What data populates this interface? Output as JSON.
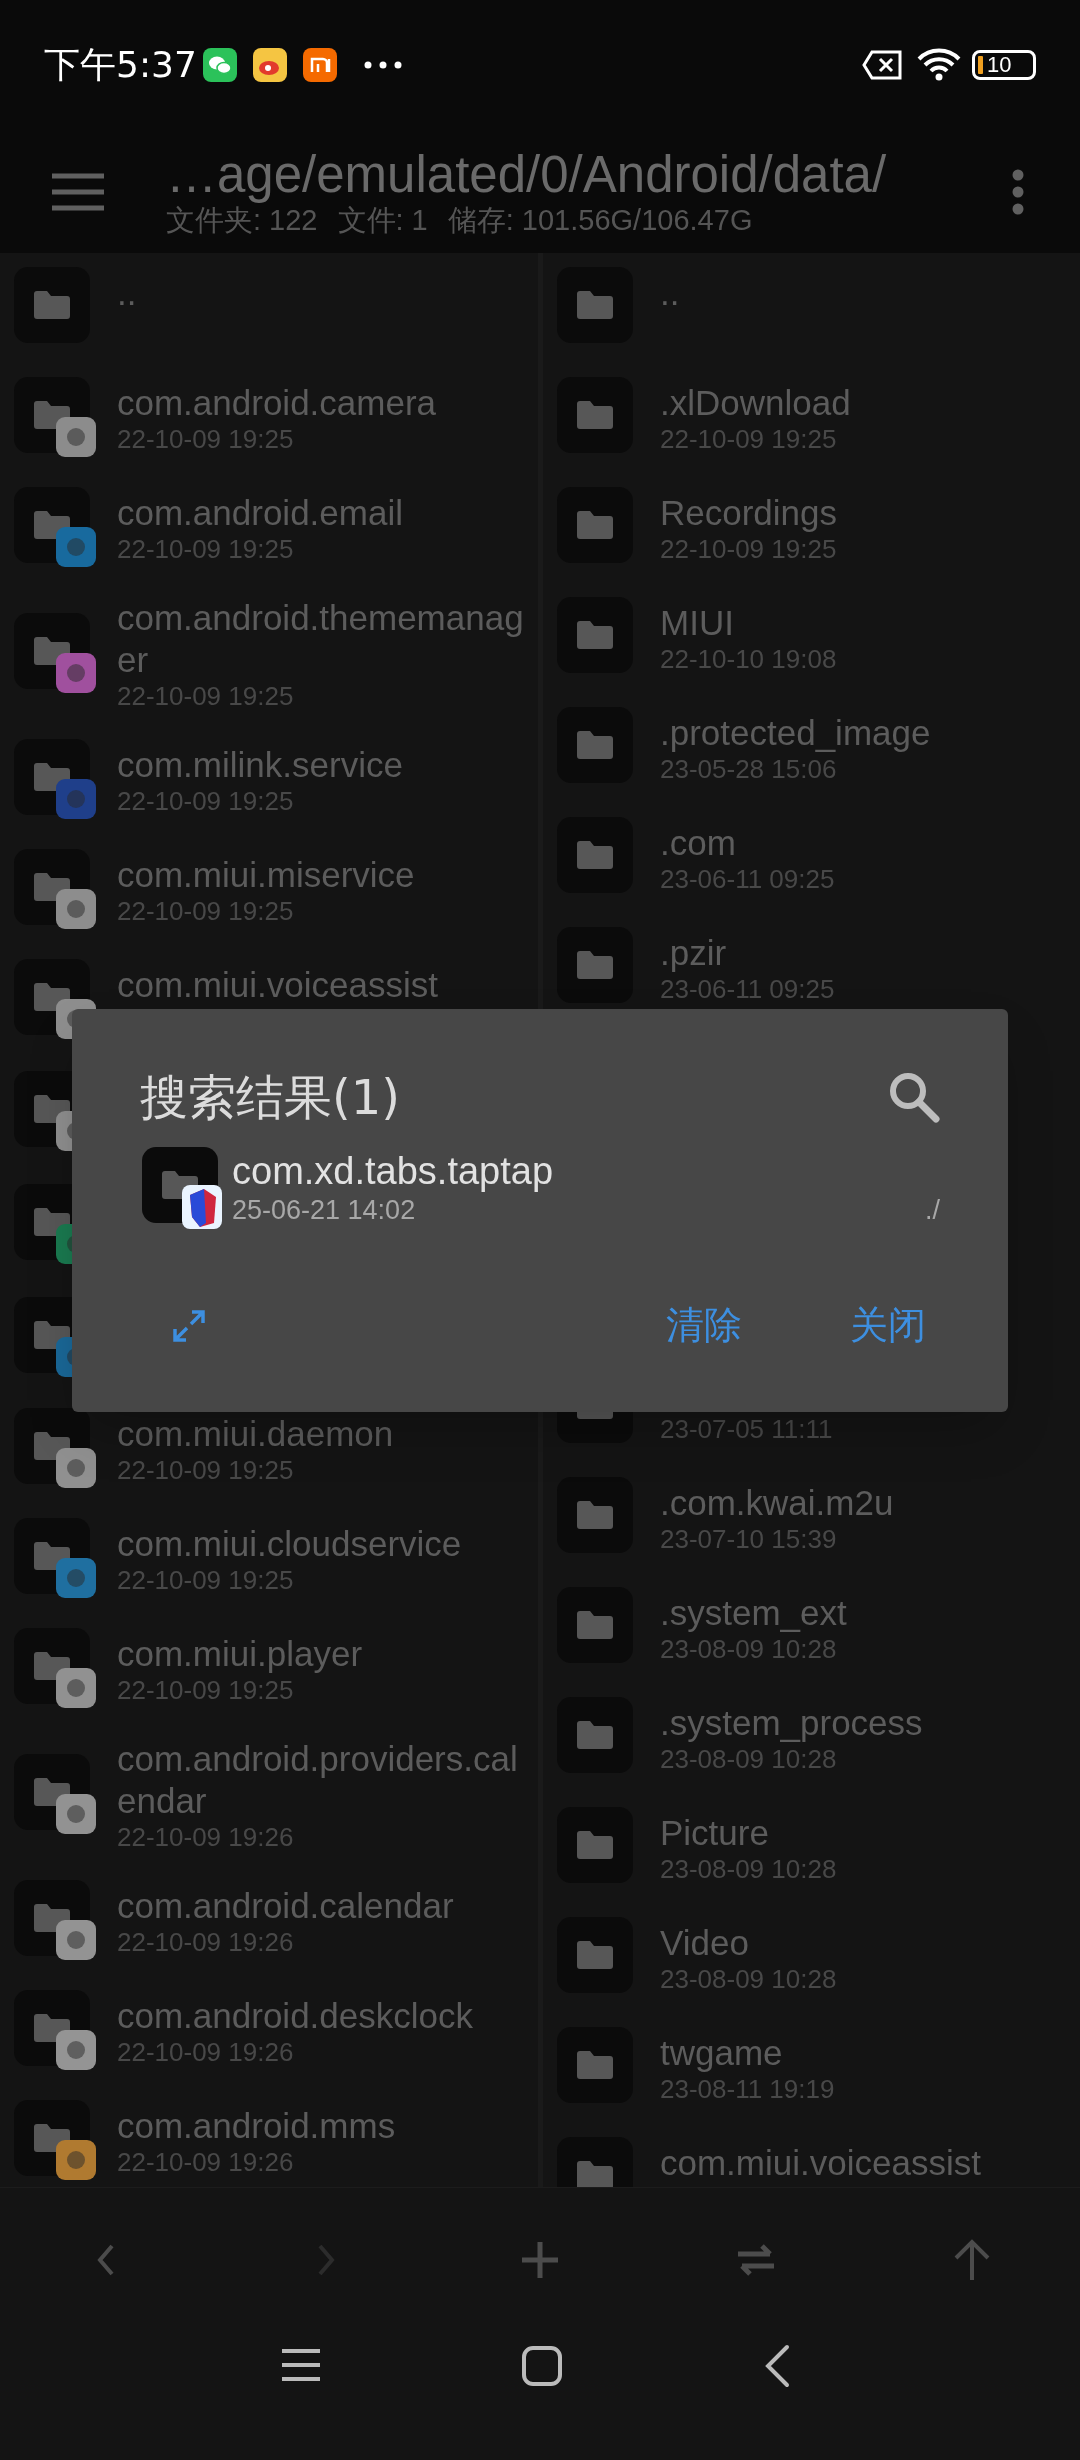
{
  "status_bar": {
    "time": "下午5:37",
    "battery": "10"
  },
  "header": {
    "path": "…age/emulated/0/Android/data/",
    "info": [
      "文件夹: 122",
      "文件: 1",
      "储存: 101.56G/106.47G"
    ]
  },
  "left_pane": {
    "items": [
      {
        "name": ".."
      },
      {
        "name": "com.android.camera",
        "date": "22-10-09 19:25",
        "color": "#8c8c8c"
      },
      {
        "name": "com.android.email",
        "date": "22-10-09 19:25",
        "color": "#186a9e"
      },
      {
        "name": "com.android.thememanager",
        "date": "22-10-09 19:25",
        "color": "#a0509e"
      },
      {
        "name": "com.milink.service",
        "date": "22-10-09 19:25",
        "color": "#1f3f8a"
      },
      {
        "name": "com.miui.miservice",
        "date": "22-10-09 19:25",
        "color": "#8d8d8d"
      },
      {
        "name": "com.miui.voiceassist",
        "color": "#8e8e8e"
      },
      {
        "color": "#8f8f8f"
      },
      {
        "color": "#1a7a50"
      },
      {
        "color": "#1a6898"
      },
      {
        "name": "com.miui.daemon",
        "date": "22-10-09 19:25",
        "color": "#909090"
      },
      {
        "name": "com.miui.cloudservice",
        "date": "22-10-09 19:25",
        "color": "#1f6fa0"
      },
      {
        "name": "com.miui.player",
        "date": "22-10-09 19:25",
        "color": "#919191"
      },
      {
        "name": "com.android.providers.calendar",
        "date": "22-10-09 19:26",
        "color": "#929292"
      },
      {
        "name": "com.android.calendar",
        "date": "22-10-09 19:26",
        "color": "#939393"
      },
      {
        "name": "com.android.deskclock",
        "date": "22-10-09 19:26",
        "color": "#949494"
      },
      {
        "name": "com.android.mms",
        "date": "22-10-09 19:26",
        "color": "#b07a30"
      }
    ]
  },
  "right_pane": {
    "items": [
      {
        "name": ".."
      },
      {
        "name": ".xlDownload",
        "date": "22-10-09 19:25"
      },
      {
        "name": "Recordings",
        "date": "22-10-09 19:25"
      },
      {
        "name": "MIUI",
        "date": "22-10-10 19:08"
      },
      {
        "name": ".protected_image",
        "date": "23-05-28 15:06"
      },
      {
        "name": ".com",
        "date": "23-06-11 09:25"
      },
      {
        "name": ".pzir",
        "date": "23-06-11 09:25"
      },
      {
        "date": "23-07-05 11:11"
      },
      {
        "name": ".com.kwai.m2u",
        "date": "23-07-10 15:39"
      },
      {
        "name": ".system_ext",
        "date": "23-08-09 10:28"
      },
      {
        "name": ".system_process",
        "date": "23-08-09 10:28"
      },
      {
        "name": "Picture",
        "date": "23-08-09 10:28"
      },
      {
        "name": "Video",
        "date": "23-08-09 10:28"
      },
      {
        "name": "twgame",
        "date": "23-08-11 19:19"
      },
      {
        "name": "com.miui.voiceassist"
      }
    ]
  },
  "dialog": {
    "title": "搜索结果(1)",
    "results": [
      {
        "name": "com.xd.tabs.taptap",
        "date": "25-06-21 14:02",
        "path": "./"
      }
    ],
    "buttons": [
      "清除",
      "关闭"
    ]
  },
  "toolbar": [
    {
      "kind": "back",
      "disabled": false
    },
    {
      "kind": "forward",
      "disabled": true
    },
    {
      "kind": "add",
      "disabled": false
    },
    {
      "kind": "swap",
      "disabled": false
    },
    {
      "kind": "up",
      "disabled": false
    }
  ]
}
